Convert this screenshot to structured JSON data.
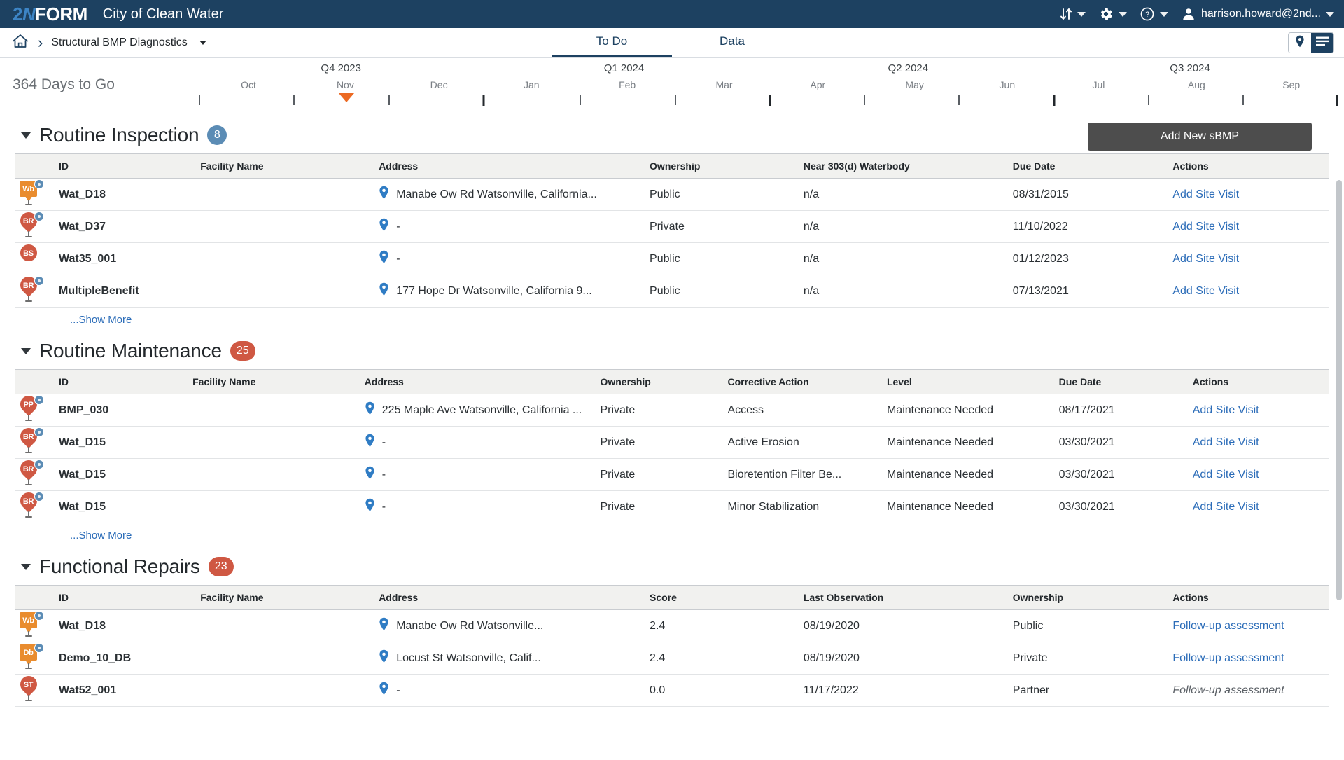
{
  "topbar": {
    "brand_2": "2",
    "brand_n": "N",
    "brand_form": "FORM",
    "org_name": "City of Clean Water",
    "sync_icon": "sort-arrows-icon",
    "gear_icon": "gear-icon",
    "help_icon": "question-circle-icon",
    "user_icon": "user-avatar-icon",
    "user_name": "harrison.howard@2nd..."
  },
  "breadcrumb": {
    "home_icon": "home-icon",
    "separator_icon": "chevron-right-icon",
    "label": "Structural BMP Diagnostics",
    "dropdown_icon": "chevron-down-icon"
  },
  "tabs": [
    {
      "label": "To Do",
      "active": true
    },
    {
      "label": "Data",
      "active": false
    }
  ],
  "view_toggle": {
    "map_icon": "map-pin-icon",
    "list_icon": "list-lines-icon",
    "active": "list"
  },
  "timeline": {
    "days_to_go": "364 Days to Go",
    "quarters": [
      {
        "label": "Q4 2023",
        "pct": 8.5
      },
      {
        "label": "Q1 2024",
        "pct": 34.5
      },
      {
        "label": "Q2 2024",
        "pct": 60.6
      },
      {
        "label": "Q3 2024",
        "pct": 86.5
      }
    ],
    "months": [
      {
        "label": "Oct",
        "pct": 0.0
      },
      {
        "label": "Nov",
        "pct": 8.9
      },
      {
        "label": "Dec",
        "pct": 17.5
      },
      {
        "label": "Jan",
        "pct": 26.0
      },
      {
        "label": "Feb",
        "pct": 34.8
      },
      {
        "label": "Mar",
        "pct": 43.7
      },
      {
        "label": "Apr",
        "pct": 52.3
      },
      {
        "label": "May",
        "pct": 61.2
      },
      {
        "label": "Jun",
        "pct": 69.7
      },
      {
        "label": "Jul",
        "pct": 78.1
      },
      {
        "label": "Aug",
        "pct": 87.1
      },
      {
        "label": "Sep",
        "pct": 95.8
      }
    ],
    "ticks": [
      {
        "pct": -4.5,
        "major": false
      },
      {
        "pct": 4.2,
        "major": false
      },
      {
        "pct": 12.9,
        "major": false
      },
      {
        "pct": 21.6,
        "major": true
      },
      {
        "pct": 30.5,
        "major": false
      },
      {
        "pct": 39.2,
        "major": false
      },
      {
        "pct": 47.9,
        "major": true
      },
      {
        "pct": 56.6,
        "major": false
      },
      {
        "pct": 65.3,
        "major": false
      },
      {
        "pct": 74.0,
        "major": true
      },
      {
        "pct": 82.7,
        "major": false
      },
      {
        "pct": 91.4,
        "major": false
      },
      {
        "pct": 100.0,
        "major": true
      }
    ],
    "today_marker_pct": 9.0,
    "marker_color": "#ec6a23"
  },
  "add_button": {
    "label": "Add New sBMP"
  },
  "sections": [
    {
      "title": "Routine Inspection",
      "count": "8",
      "count_color": "blue",
      "columns": [
        "ID",
        "Facility Name",
        "Address",
        "Ownership",
        "Near 303(d) Waterbody",
        "Due Date",
        "Actions"
      ],
      "show_more": "...Show More",
      "rows": [
        {
          "marker": {
            "style": "sq",
            "text": "Wb",
            "color": "#e98c2e",
            "badge": true,
            "stem": true
          },
          "id": "Wat_D18",
          "facility": "",
          "address": "Manabe Ow Rd Watsonville, California...",
          "ownership": "Public",
          "waterbody": "n/a",
          "due_date": "08/31/2015",
          "overdue": true,
          "action": "Add Site Visit"
        },
        {
          "marker": {
            "style": "drop",
            "text": "BR",
            "color": "#cf5843",
            "badge": true,
            "stem": true
          },
          "id": "Wat_D37",
          "facility": "",
          "address": "-",
          "ownership": "Private",
          "waterbody": "n/a",
          "due_date": "11/10/2022",
          "overdue": true,
          "action": "Add Site Visit"
        },
        {
          "marker": {
            "style": "drop",
            "text": "BS",
            "color": "#cf5843",
            "badge": false,
            "stem": false
          },
          "id": "Wat35_001",
          "facility": "",
          "address": "-",
          "ownership": "Public",
          "waterbody": "n/a",
          "due_date": "01/12/2023",
          "overdue": false,
          "action": "Add Site Visit"
        },
        {
          "marker": {
            "style": "drop",
            "text": "BR",
            "color": "#cf5843",
            "badge": true,
            "stem": true
          },
          "id": "MultipleBenefit",
          "facility": "",
          "address": "177 Hope Dr Watsonville, California 9...",
          "ownership": "Public",
          "waterbody": "n/a",
          "due_date": "07/13/2021",
          "overdue": true,
          "action": "Add Site Visit"
        }
      ]
    },
    {
      "title": "Routine Maintenance",
      "count": "25",
      "count_color": "red",
      "columns": [
        "ID",
        "Facility Name",
        "Address",
        "Ownership",
        "Corrective Action",
        "Level",
        "Due Date",
        "Actions"
      ],
      "show_more": "...Show More",
      "rows": [
        {
          "marker": {
            "style": "drop",
            "text": "PP",
            "color": "#cf5843",
            "badge": true,
            "stem": true
          },
          "id": "BMP_030",
          "facility": "",
          "address": "225 Maple Ave Watsonville, California ...",
          "ownership": "Private",
          "corrective_action": "Access",
          "level": "Maintenance Needed",
          "due_date": "08/17/2021",
          "overdue": true,
          "action": "Add Site Visit"
        },
        {
          "marker": {
            "style": "drop",
            "text": "BR",
            "color": "#cf5843",
            "badge": true,
            "stem": true
          },
          "id": "Wat_D15",
          "facility": "",
          "address": "-",
          "ownership": "Private",
          "corrective_action": "Active Erosion",
          "level": "Maintenance Needed",
          "due_date": "03/30/2021",
          "overdue": true,
          "action": "Add Site Visit"
        },
        {
          "marker": {
            "style": "drop",
            "text": "BR",
            "color": "#cf5843",
            "badge": true,
            "stem": true
          },
          "id": "Wat_D15",
          "facility": "",
          "address": "-",
          "ownership": "Private",
          "corrective_action": "Bioretention Filter Be...",
          "level": "Maintenance Needed",
          "due_date": "03/30/2021",
          "overdue": true,
          "action": "Add Site Visit"
        },
        {
          "marker": {
            "style": "drop",
            "text": "BR",
            "color": "#cf5843",
            "badge": true,
            "stem": true
          },
          "id": "Wat_D15",
          "facility": "",
          "address": "-",
          "ownership": "Private",
          "corrective_action": "Minor Stabilization",
          "level": "Maintenance Needed",
          "due_date": "03/30/2021",
          "overdue": true,
          "action": "Add Site Visit"
        }
      ]
    },
    {
      "title": "Functional Repairs",
      "count": "23",
      "count_color": "red",
      "columns": [
        "ID",
        "Facility Name",
        "Address",
        "Score",
        "Last Observation",
        "Ownership",
        "Actions"
      ],
      "show_more": "",
      "rows": [
        {
          "marker": {
            "style": "sq",
            "text": "Wb",
            "color": "#e98c2e",
            "badge": true,
            "stem": true
          },
          "id": "Wat_D18",
          "facility": "",
          "address": "Manabe Ow Rd Watsonville...",
          "score": "2.4",
          "score_color": "amber",
          "last_observation": "08/19/2020",
          "ownership": "Public",
          "action": "Follow-up assessment",
          "action_disabled": false
        },
        {
          "marker": {
            "style": "sq",
            "text": "Db",
            "color": "#e98c2e",
            "badge": true,
            "stem": true
          },
          "id": "Demo_10_DB",
          "facility": "",
          "address": "Locust St Watsonville, Calif...",
          "score": "2.4",
          "score_color": "amber",
          "last_observation": "08/19/2020",
          "ownership": "Private",
          "action": "Follow-up assessment",
          "action_disabled": false
        },
        {
          "marker": {
            "style": "drop",
            "text": "ST",
            "color": "#cf5843",
            "badge": false,
            "stem": true
          },
          "id": "Wat52_001",
          "facility": "",
          "address": "-",
          "score": "0.0",
          "score_color": "red",
          "last_observation": "11/17/2022",
          "ownership": "Partner",
          "action": "Follow-up assessment",
          "action_disabled": true
        }
      ]
    }
  ],
  "colors": {
    "nav_bg": "#1d4161",
    "accent_blue": "#2b6cb8",
    "overdue_red": "#e0533a",
    "marker_orange": "#ec6a23",
    "badge_blue": "#5b8cb5",
    "badge_red": "#cf5843"
  }
}
